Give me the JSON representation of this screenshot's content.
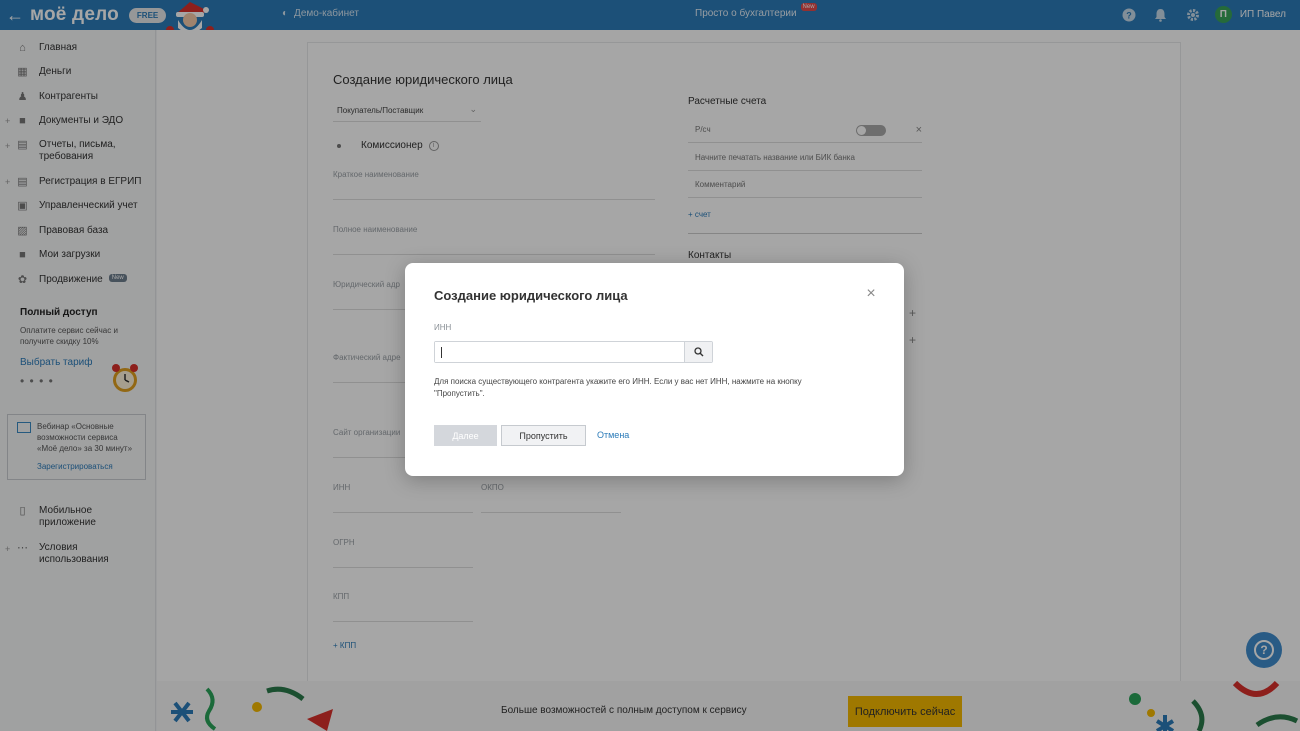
{
  "topbar": {
    "logo": "моё дело",
    "free_badge": "FREE",
    "demo_label": "Демо-кабинет",
    "simple_label": "Просто о бухгалтерии",
    "simple_new": "New",
    "user_initial": "П",
    "user_name": "ИП Павел"
  },
  "sidebar": {
    "items": [
      {
        "label": "Главная",
        "icon": "home-icon"
      },
      {
        "label": "Деньги",
        "icon": "money-icon"
      },
      {
        "label": "Контрагенты",
        "icon": "contractors-icon"
      },
      {
        "label": "Документы и ЭДО",
        "icon": "folder-icon"
      },
      {
        "label": "Отчеты, письма, требования",
        "icon": "reports-icon"
      },
      {
        "label": "Регистрация в ЕГРИП",
        "icon": "registration-icon"
      },
      {
        "label": "Управленческий учет",
        "icon": "chart-icon"
      },
      {
        "label": "Правовая база",
        "icon": "law-icon"
      },
      {
        "label": "Мои загрузки",
        "icon": "downloads-icon"
      },
      {
        "label": "Продвижение",
        "icon": "promotion-icon",
        "badge": "New"
      }
    ],
    "promo": {
      "title": "Полный доступ",
      "desc": "Оплатите сервис сейчас и получите скидку 10%",
      "link": "Выбрать тариф",
      "dots": "• • • •"
    },
    "webinar": {
      "text": "Вебинар «Основные возможности сервиса «Моё дело» за 30 минут»",
      "link": "Зарегистрироваться"
    },
    "bottom": [
      {
        "label": "Мобильное приложение",
        "icon": "mobile-icon"
      },
      {
        "label": "Условия использования",
        "icon": "more-icon"
      }
    ]
  },
  "form": {
    "title": "Создание юридического лица",
    "type_select": "Покупатель/Поставщик",
    "commissioner": "Комиссионер",
    "fields": {
      "short_name": "Краткое наименование",
      "full_name": "Полное наименование",
      "legal_address": "Юридический адр",
      "actual_address": "Фактический адре",
      "website": "Сайт организации",
      "inn": "ИНН",
      "okpo": "ОКПО",
      "ogrn": "ОГРН",
      "kpp": "КПП"
    },
    "add_kpp": "КПП",
    "accounts": {
      "title": "Расчетные счета",
      "account": "Р/сч",
      "bank": "Начните печатать название или БИК банка",
      "comment": "Комментарий",
      "add": "счет"
    },
    "contacts_title": "Контакты"
  },
  "banner": {
    "text": "Больше возможностей с полным доступом к сервису",
    "button": "Подключить сейчас"
  },
  "modal": {
    "title": "Создание юридического лица",
    "inn_label": "ИНН",
    "inn_value": "",
    "hint": "Для поиска существующего контрагента укажите его ИНН. Если у вас нет ИНН, нажмите на кнопку \"Пропустить\".",
    "next": "Далее",
    "skip": "Пропустить",
    "cancel": "Отмена"
  },
  "colors": {
    "brand": "#2b7bb9",
    "accent_yellow": "#f5b800",
    "overlay": "rgba(0,0,0,0.35)"
  }
}
